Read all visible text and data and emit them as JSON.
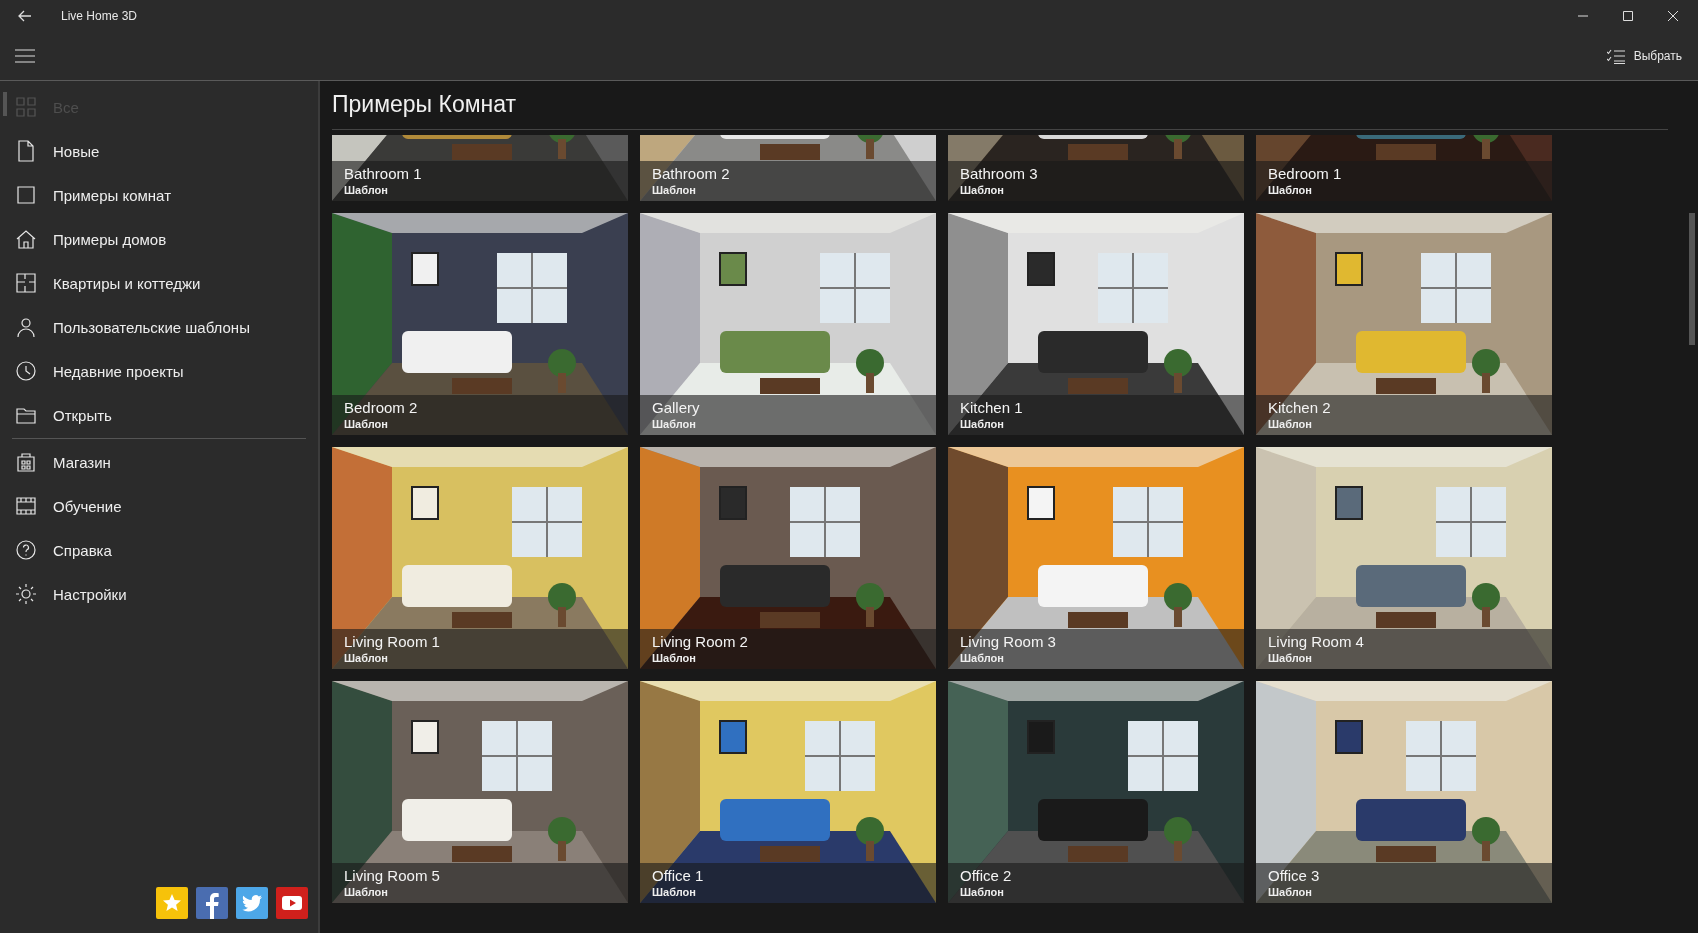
{
  "window": {
    "title": "Live Home 3D"
  },
  "toolbar": {
    "select_button": "Выбрать"
  },
  "sidebar": {
    "sections": [
      {
        "items": [
          {
            "label": "Все",
            "selected": true,
            "disabled": true
          },
          {
            "label": "Новые",
            "selected": false,
            "disabled": false
          },
          {
            "label": "Примеры комнат",
            "selected": false,
            "disabled": false
          },
          {
            "label": "Примеры домов",
            "selected": false,
            "disabled": false
          },
          {
            "label": "Квартиры и коттеджи",
            "selected": false,
            "disabled": false
          },
          {
            "label": "Пользовательские шаблоны",
            "selected": false,
            "disabled": false
          },
          {
            "label": "Недавние проекты",
            "selected": false,
            "disabled": false
          },
          {
            "label": "Открыть",
            "selected": false,
            "disabled": false
          }
        ]
      },
      {
        "items": [
          {
            "label": "Магазин",
            "selected": false,
            "disabled": false
          },
          {
            "label": "Обучение",
            "selected": false,
            "disabled": false
          },
          {
            "label": "Справка",
            "selected": false,
            "disabled": false
          },
          {
            "label": "Настройки",
            "selected": false,
            "disabled": false
          }
        ]
      }
    ]
  },
  "content": {
    "heading": "Примеры Комнат",
    "tiles": [
      {
        "title": "Bathroom 1",
        "subtitle": "Шаблон"
      },
      {
        "title": "Bathroom 2",
        "subtitle": "Шаблон"
      },
      {
        "title": "Bathroom 3",
        "subtitle": "Шаблон"
      },
      {
        "title": "Bedroom 1",
        "subtitle": "Шаблон"
      },
      {
        "title": "Bedroom 2",
        "subtitle": "Шаблон"
      },
      {
        "title": "Gallery",
        "subtitle": "Шаблон"
      },
      {
        "title": "Kitchen 1",
        "subtitle": "Шаблон"
      },
      {
        "title": "Kitchen 2",
        "subtitle": "Шаблон"
      },
      {
        "title": "Living Room 1",
        "subtitle": "Шаблон"
      },
      {
        "title": "Living Room 2",
        "subtitle": "Шаблон"
      },
      {
        "title": "Living Room 3",
        "subtitle": "Шаблон"
      },
      {
        "title": "Living Room 4",
        "subtitle": "Шаблон"
      },
      {
        "title": "Living Room 5",
        "subtitle": "Шаблон"
      },
      {
        "title": "Office 1",
        "subtitle": "Шаблон"
      },
      {
        "title": "Office 2",
        "subtitle": "Шаблон"
      },
      {
        "title": "Office 3",
        "subtitle": "Шаблон"
      }
    ]
  }
}
